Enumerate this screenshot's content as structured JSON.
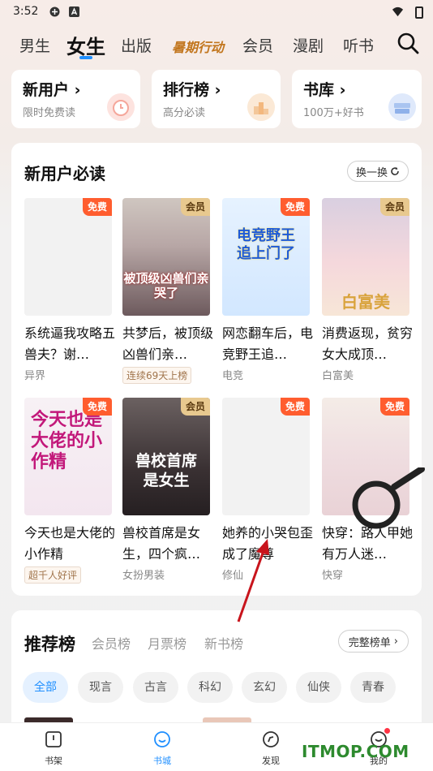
{
  "status_bar": {
    "time": "3:52"
  },
  "top_tabs": [
    {
      "label": "男生",
      "active": false
    },
    {
      "label": "女生",
      "active": true
    },
    {
      "label": "出版",
      "active": false
    },
    {
      "label": "暑期行动",
      "active": false,
      "promo": true
    },
    {
      "label": "会员",
      "active": false
    },
    {
      "label": "漫剧",
      "active": false
    },
    {
      "label": "听书",
      "active": false
    }
  ],
  "quick_cards": [
    {
      "title": "新用户 ›",
      "subtitle": "限时免费读"
    },
    {
      "title": "排行榜 ›",
      "subtitle": "高分必读"
    },
    {
      "title": "书库 ›",
      "subtitle": "100万+好书"
    }
  ],
  "new_user_section": {
    "title": "新用户必读",
    "refresh_label": "换一换",
    "books": [
      {
        "badge": "免费",
        "badge_type": "free",
        "title": "系统逼我攻略五兽夫？谢…",
        "tag": "异界",
        "tag_box": false,
        "cover_text": ""
      },
      {
        "badge": "会员",
        "badge_type": "vip",
        "title": "共梦后，被顶级凶兽们亲…",
        "tag": "连续69天上榜",
        "tag_box": true,
        "cover_text": "被顶级凶兽们亲哭了"
      },
      {
        "badge": "免费",
        "badge_type": "free",
        "title": "网恋翻车后，电竞野王追…",
        "tag": "电竞",
        "tag_box": false,
        "cover_text": "电竞野王追上门了"
      },
      {
        "badge": "会员",
        "badge_type": "vip",
        "title": "消费返现，贫穷女大成顶…",
        "tag": "白富美",
        "tag_box": false,
        "cover_text": "白富美"
      },
      {
        "badge": "免费",
        "badge_type": "free",
        "title": "今天也是大佬的小作精",
        "tag": "超千人好评",
        "tag_box": true,
        "cover_text": "今天也是大佬的小作精"
      },
      {
        "badge": "会员",
        "badge_type": "vip",
        "title": "兽校首席是女生，四个疯…",
        "tag": "女扮男装",
        "tag_box": false,
        "cover_text": "兽校首席是女生"
      },
      {
        "badge": "免费",
        "badge_type": "free",
        "title": "她养的小哭包歪成了魔尊",
        "tag": "修仙",
        "tag_box": false,
        "cover_text": ""
      },
      {
        "badge": "免费",
        "badge_type": "free",
        "title": "快穿：路人甲她有万人迷…",
        "tag": "快穿",
        "tag_box": false,
        "cover_text": ""
      }
    ]
  },
  "ranking_section": {
    "tabs": [
      {
        "label": "推荐榜",
        "active": true
      },
      {
        "label": "会员榜",
        "active": false
      },
      {
        "label": "月票榜",
        "active": false
      },
      {
        "label": "新书榜",
        "active": false
      }
    ],
    "full_list_label": "完整榜单",
    "chips": [
      {
        "label": "全部",
        "active": true
      },
      {
        "label": "现言",
        "active": false
      },
      {
        "label": "古言",
        "active": false
      },
      {
        "label": "科幻",
        "active": false
      },
      {
        "label": "玄幻",
        "active": false
      },
      {
        "label": "仙侠",
        "active": false
      },
      {
        "label": "青春",
        "active": false
      }
    ]
  },
  "bottom_nav": [
    {
      "label": "书架",
      "icon": "bookshelf-icon",
      "active": false
    },
    {
      "label": "书城",
      "icon": "bookstore-icon",
      "active": true
    },
    {
      "label": "发现",
      "icon": "compass-icon",
      "active": false
    },
    {
      "label": "我的",
      "icon": "profile-icon",
      "active": false
    }
  ],
  "watermark": "ITMOP.COM",
  "colors": {
    "accent": "#1f8fff",
    "free_badge": "#ff5d2f",
    "vip_badge": "#e8c98f"
  }
}
